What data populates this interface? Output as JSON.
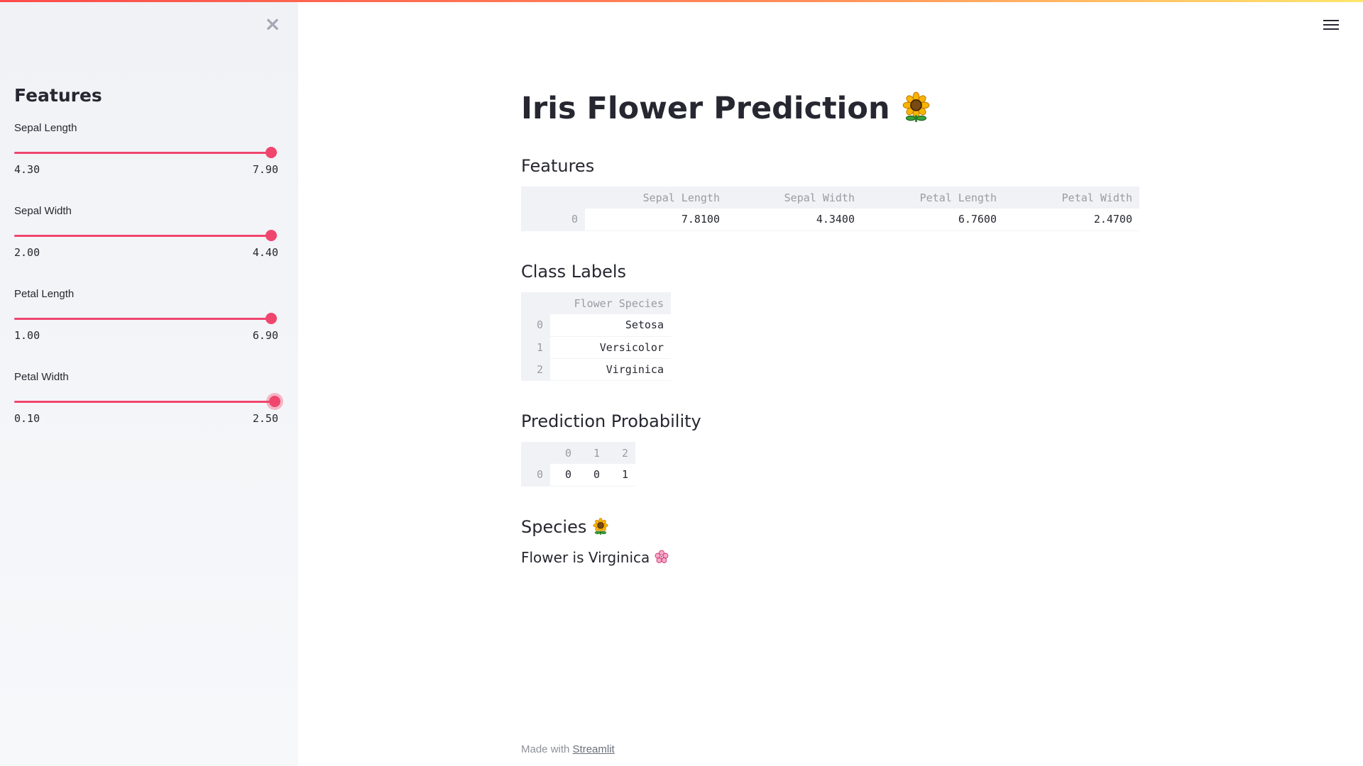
{
  "app": {
    "close_icon": "close-icon",
    "menu_icon": "hamburger-menu-icon",
    "accent_color": "#f0466e"
  },
  "sidebar": {
    "title": "Features",
    "sliders": [
      {
        "label": "Sepal Length",
        "min": "4.30",
        "max": "7.90",
        "value": 7.81,
        "value_fraction": 0.975
      },
      {
        "label": "Sepal Width",
        "min": "2.00",
        "max": "4.40",
        "value": 4.34,
        "value_fraction": 0.975
      },
      {
        "label": "Petal Length",
        "min": "1.00",
        "max": "6.90",
        "value": 6.76,
        "value_fraction": 0.976
      },
      {
        "label": "Petal Width",
        "min": "0.10",
        "max": "2.50",
        "value": 2.47,
        "value_fraction": 0.988
      }
    ]
  },
  "main": {
    "title": "Iris Flower Prediction",
    "title_icon": "sunflower-icon",
    "features_header": "Features",
    "features_table": {
      "columns": [
        "Sepal Length",
        "Sepal Width",
        "Petal Length",
        "Petal Width"
      ],
      "rows": [
        {
          "index": "0",
          "values": [
            "7.8100",
            "4.3400",
            "6.7600",
            "2.4700"
          ]
        }
      ]
    },
    "class_labels_header": "Class Labels",
    "class_labels_table": {
      "columns": [
        "Flower Species"
      ],
      "rows": [
        {
          "index": "0",
          "values": [
            "Setosa"
          ]
        },
        {
          "index": "1",
          "values": [
            "Versicolor"
          ]
        },
        {
          "index": "2",
          "values": [
            "Virginica"
          ]
        }
      ]
    },
    "probability_header": "Prediction Probability",
    "probability_table": {
      "columns": [
        "0",
        "1",
        "2"
      ],
      "rows": [
        {
          "index": "0",
          "values": [
            "0",
            "0",
            "1"
          ]
        }
      ]
    },
    "species_header": "Species",
    "species_icon": "sunflower-icon",
    "result_text": "Flower is Virginica",
    "result_icon": "cherry-blossom-icon"
  },
  "footer": {
    "prefix": "Made with",
    "link_text": "Streamlit"
  }
}
